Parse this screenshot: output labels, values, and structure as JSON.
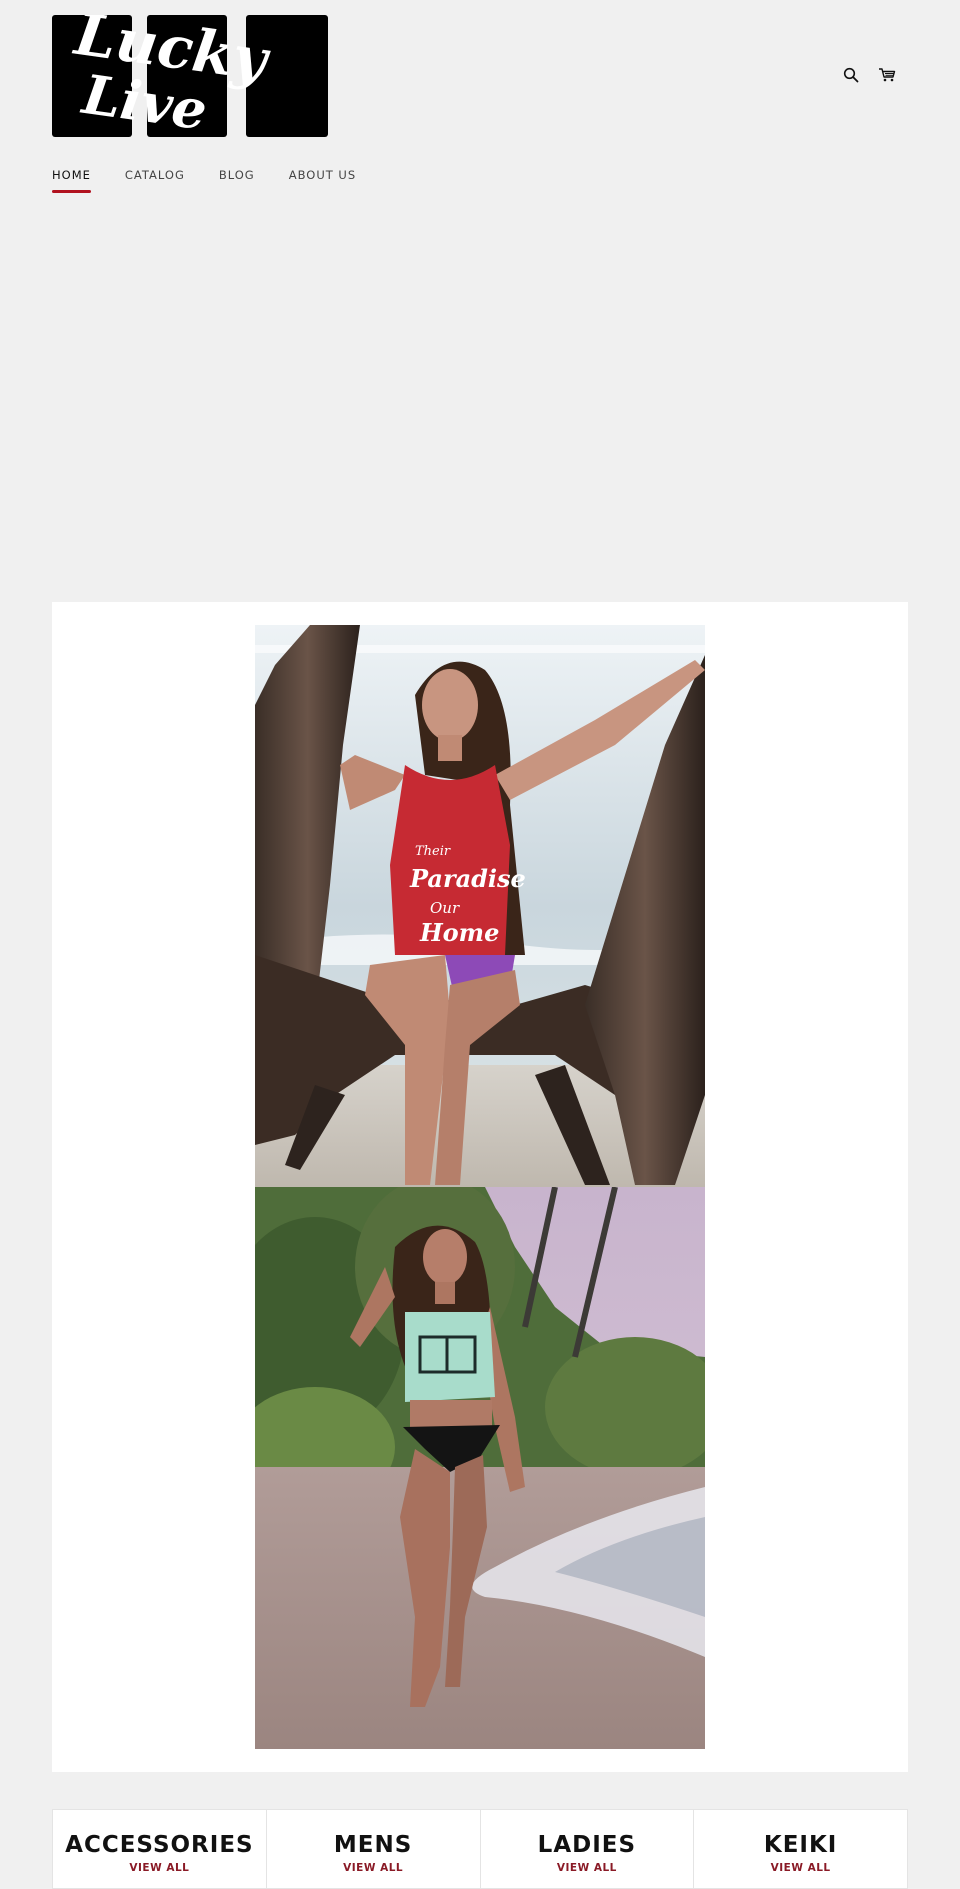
{
  "brand": {
    "logo_line1": "Lucky",
    "logo_line2": "Live",
    "logo_background": "#000000",
    "logo_text_color": "#ffffff"
  },
  "header": {
    "icons": [
      "search-icon",
      "cart-icon"
    ]
  },
  "nav": {
    "items": [
      {
        "label": "HOME",
        "active": true
      },
      {
        "label": "CATALOG",
        "active": false
      },
      {
        "label": "BLOG",
        "active": false
      },
      {
        "label": "ABOUT US",
        "active": false
      }
    ],
    "accent_color": "#b1121f"
  },
  "feature": {
    "photos": [
      {
        "subject": "woman in red tank top sitting on driftwood at the beach"
      },
      {
        "subject": "woman in mint crop top walking on the beach at dusk"
      }
    ],
    "shirt_print": [
      "Their",
      "Paradise",
      "Our",
      "Home"
    ]
  },
  "collections": {
    "items": [
      {
        "title": "ACCESSORIES",
        "link_label": "VIEW ALL"
      },
      {
        "title": "MENS",
        "link_label": "VIEW ALL"
      },
      {
        "title": "LADIES",
        "link_label": "VIEW ALL"
      },
      {
        "title": "KEIKI",
        "link_label": "VIEW ALL"
      }
    ],
    "link_color": "#8a1a26"
  }
}
